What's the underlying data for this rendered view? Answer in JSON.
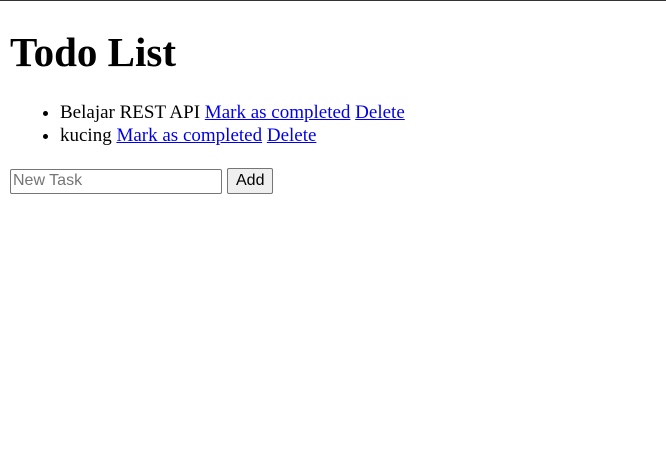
{
  "page": {
    "title": "Todo List"
  },
  "todos": [
    {
      "text": "Belajar REST API",
      "complete_label": "Mark as completed",
      "delete_label": "Delete"
    },
    {
      "text": "kucing",
      "complete_label": "Mark as completed",
      "delete_label": "Delete"
    }
  ],
  "form": {
    "input_value": "",
    "input_placeholder": "New Task",
    "add_label": "Add"
  },
  "colors": {
    "link": "#0000ee",
    "text": "#000000",
    "background": "#ffffff"
  }
}
